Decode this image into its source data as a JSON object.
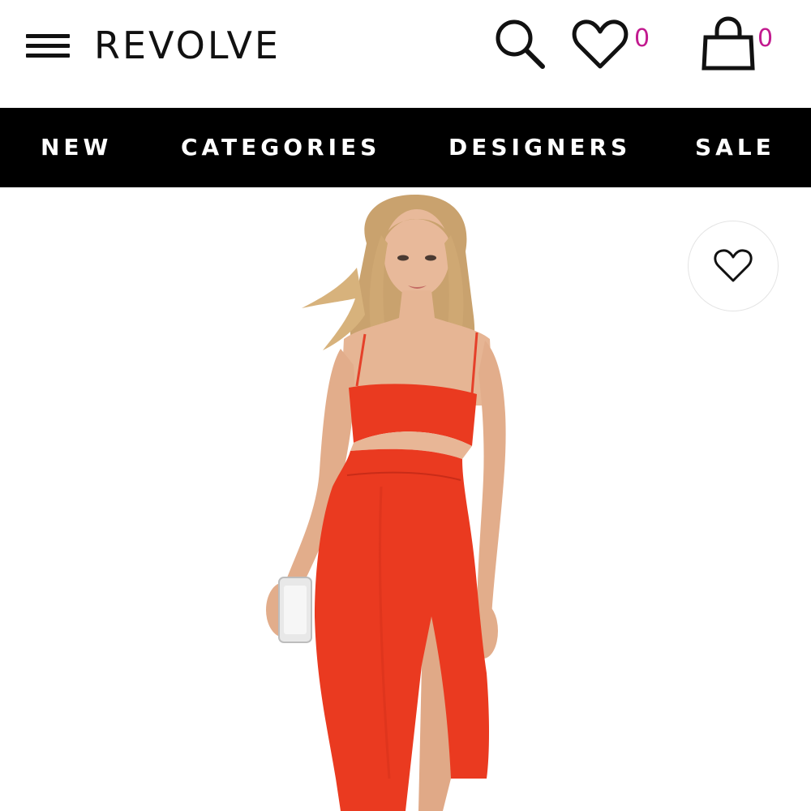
{
  "header": {
    "logo": "REVOLVE",
    "wishlist_count": "0",
    "bag_count": "0",
    "icons": {
      "menu": "hamburger-menu-icon",
      "search": "search-icon",
      "wishlist": "heart-icon",
      "bag": "shopping-bag-icon"
    }
  },
  "nav": {
    "items": [
      {
        "label": "NEW"
      },
      {
        "label": "CATEGORIES"
      },
      {
        "label": "DESIGNERS"
      },
      {
        "label": "SALE"
      }
    ]
  },
  "product": {
    "favorite_icon": "heart-outline-icon",
    "image_alt": "Model wearing red cut-out midi dress with side slit",
    "colors": {
      "dress": "#ea3a20",
      "background": "#ffffff",
      "count_accent": "#c21a8f"
    }
  }
}
